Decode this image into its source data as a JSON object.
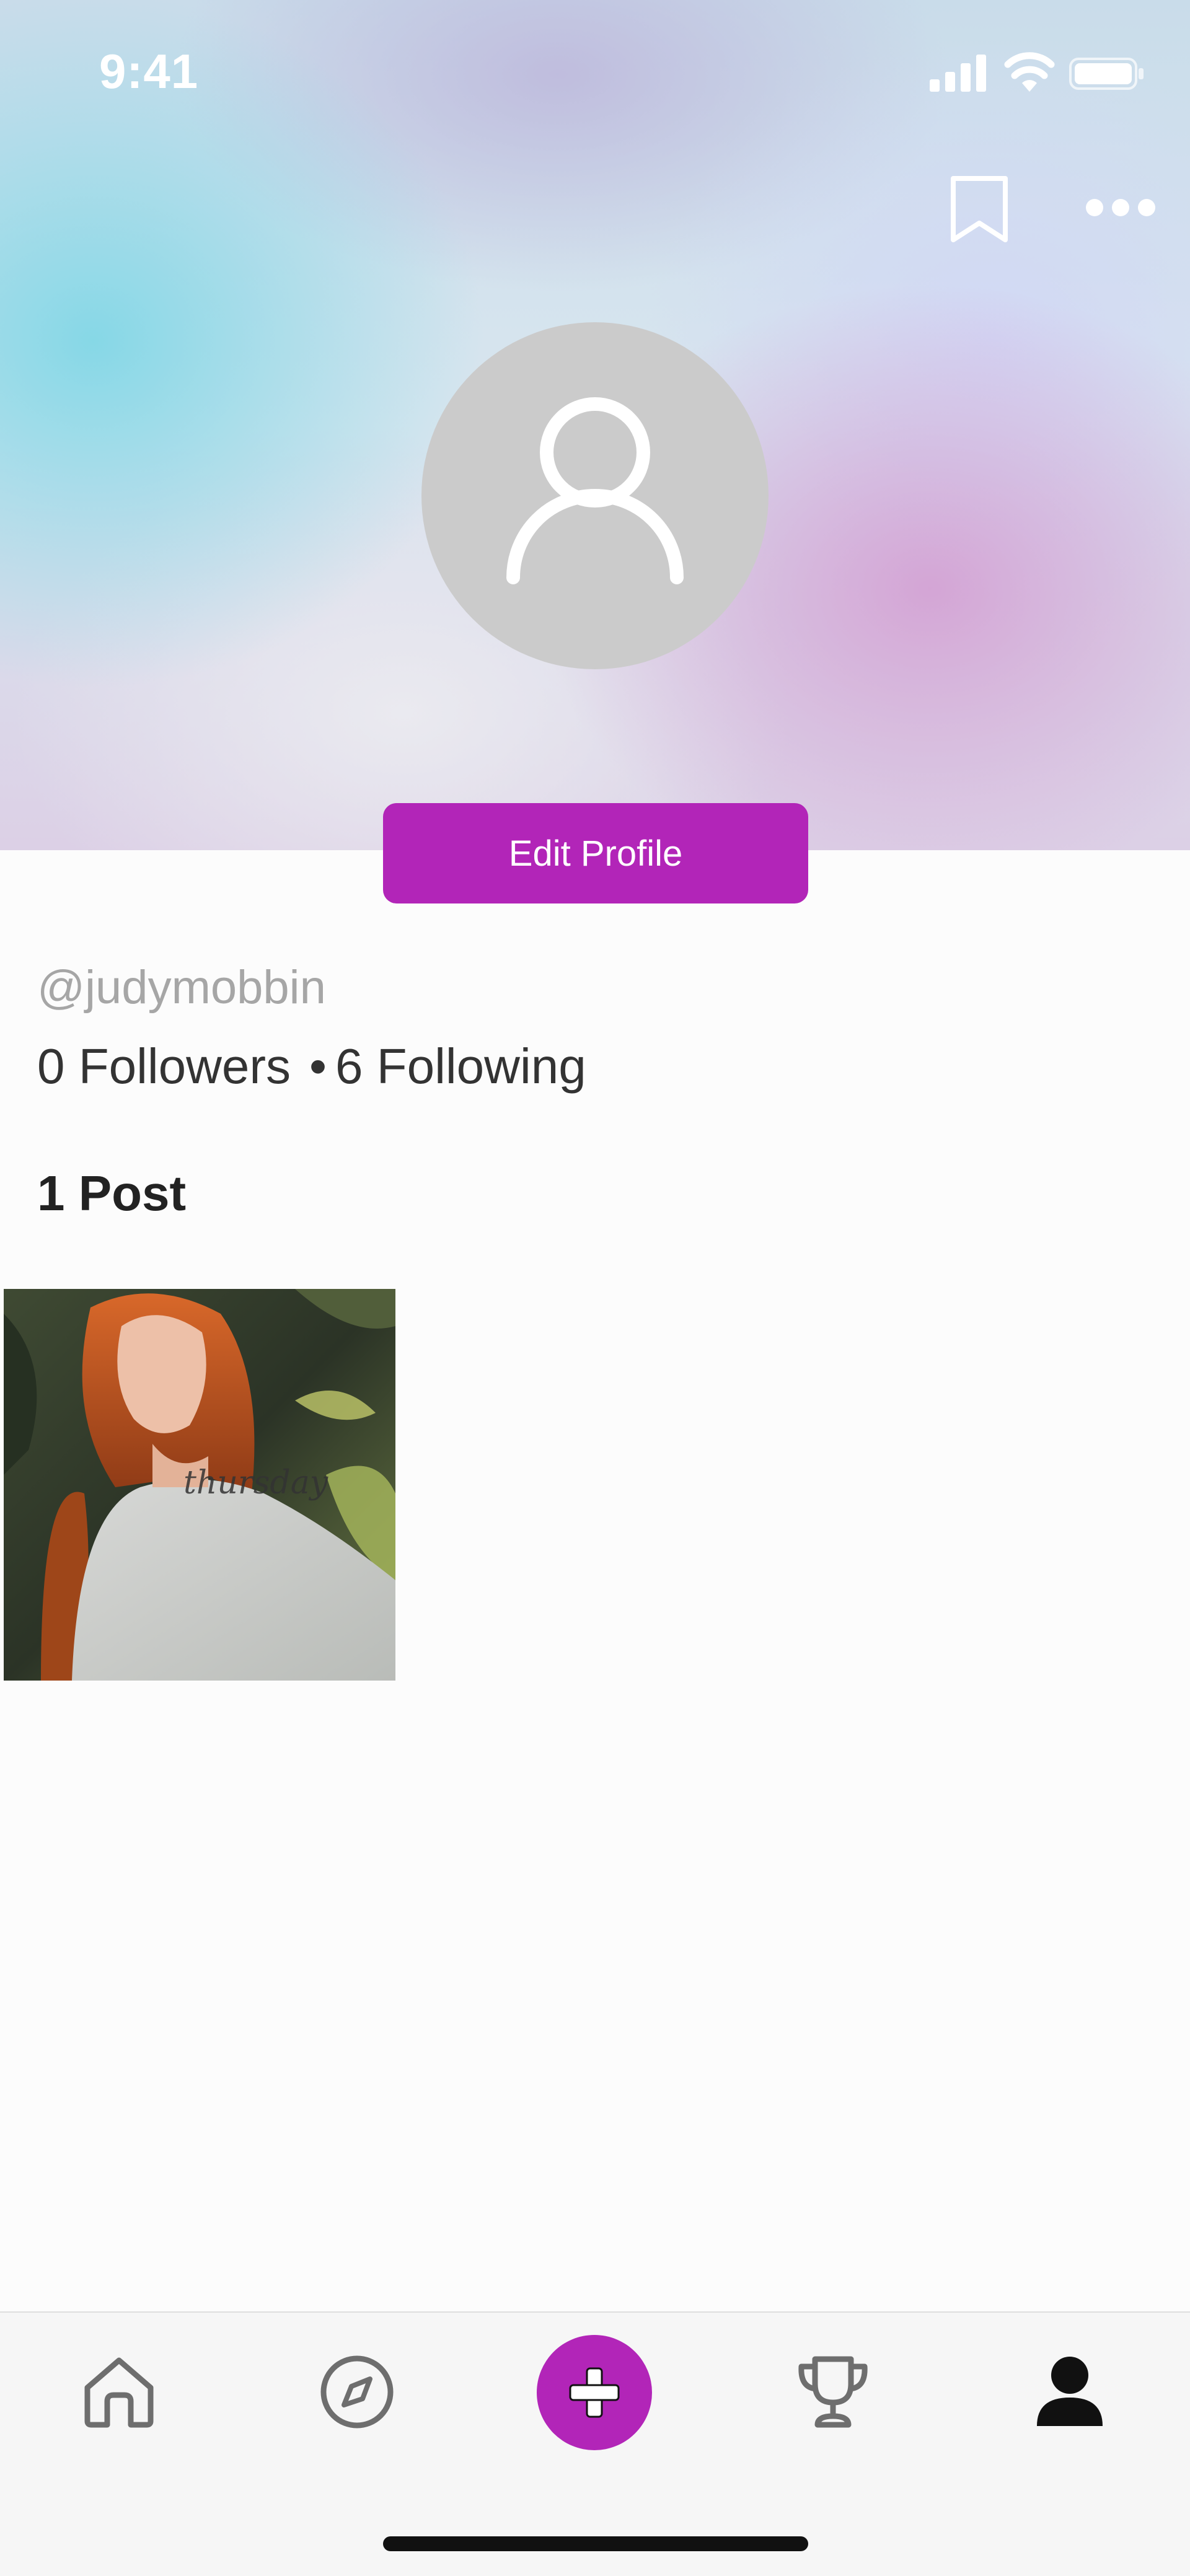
{
  "status_bar": {
    "time": "9:41"
  },
  "profile": {
    "edit_button_label": "Edit Profile",
    "username": "@judymobbin",
    "followers_label": "0 Followers",
    "following_label": "6 Following",
    "separator": "•",
    "posts_label": "1 Post"
  },
  "posts": [
    {
      "caption_script": "thursday"
    }
  ],
  "tab_bar": {
    "items": [
      {
        "icon": "home-icon",
        "selected": false
      },
      {
        "icon": "compass-icon",
        "selected": false
      },
      {
        "icon": "plus-icon",
        "selected": false
      },
      {
        "icon": "trophy-icon",
        "selected": false
      },
      {
        "icon": "profile-icon",
        "selected": true
      }
    ]
  },
  "colors": {
    "accent": "#b225b8",
    "username_gray": "#a6a6a6",
    "text_dark": "#333333",
    "avatar_gray": "#cbcbcb"
  }
}
